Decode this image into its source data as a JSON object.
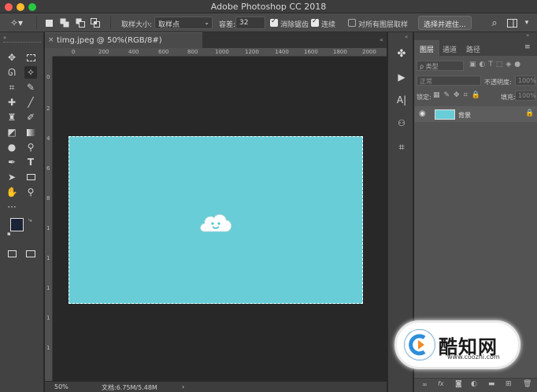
{
  "window": {
    "title": "Adobe Photoshop CC 2018"
  },
  "options_bar": {
    "sample_size_label": "取样大小:",
    "sample_size_value": "取样点",
    "tolerance_label": "容差:",
    "tolerance_value": "32",
    "anti_alias_label": "消除锯齿",
    "anti_alias_checked": true,
    "contiguous_label": "连续",
    "contiguous_checked": true,
    "sample_all_layers_label": "对所有图层取样",
    "sample_all_layers_checked": false,
    "select_mask_button": "选择并遮住..."
  },
  "document": {
    "tab_label": "timg.jpeg @ 50%(RGB/8#)",
    "h_ruler_ticks": [
      "0",
      "200",
      "400",
      "600",
      "800",
      "1000",
      "1200",
      "1400",
      "1600",
      "1800",
      "2000"
    ],
    "v_ruler_ticks": [
      "0",
      "2",
      "4",
      "6",
      "8",
      "1",
      "1",
      "1",
      "1",
      "1"
    ],
    "image_color": "#68cdd6",
    "zoom": "50%",
    "doc_size": "文档:6.75M/5.48M"
  },
  "layers_panel": {
    "tabs": [
      "图层",
      "通道",
      "路径"
    ],
    "active_tab": "图层",
    "filter_kind": "ρ 类型",
    "blend_mode": "正常",
    "opacity_label": "不透明度:",
    "opacity_value": "100%",
    "lock_label": "锁定:",
    "fill_label": "填充:",
    "fill_value": "100%",
    "layers": [
      {
        "name": "背景",
        "visible": true,
        "locked": true
      }
    ]
  },
  "watermark": {
    "brand": "酷知网",
    "url": "www.coozhi.com"
  }
}
